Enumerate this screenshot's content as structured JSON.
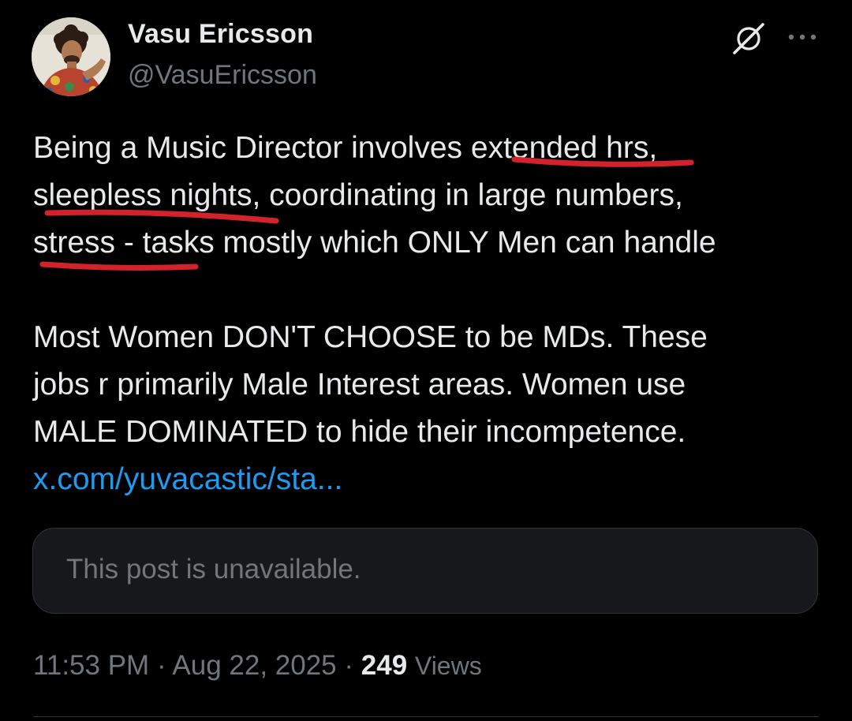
{
  "post": {
    "author": {
      "display_name": "Vasu Ericsson",
      "handle": "@VasuEricsson",
      "avatar": "profile-photo"
    },
    "icons": {
      "grok": "grok-icon",
      "more": "more-options-icon"
    },
    "text_lines": [
      "Being a Music Director involves extended hrs,",
      "sleepless nights, coordinating in large numbers,",
      "stress - tasks mostly which ONLY Men can handle",
      "Most Women DON'T CHOOSE to be MDs. These",
      "jobs r primarily Male Interest areas. Women use",
      "MALE DOMINATED to hide their incompetence."
    ],
    "link": "x.com/yuvacastic/sta...",
    "quote": {
      "text": "This post is unavailable."
    },
    "meta": {
      "time": "11:53 PM",
      "separator": "·",
      "date": "Aug 22, 2025",
      "views_count": "249",
      "views_label": "Views"
    },
    "annotation_color": "#d2232a",
    "link_color": "#1d9bf0"
  }
}
